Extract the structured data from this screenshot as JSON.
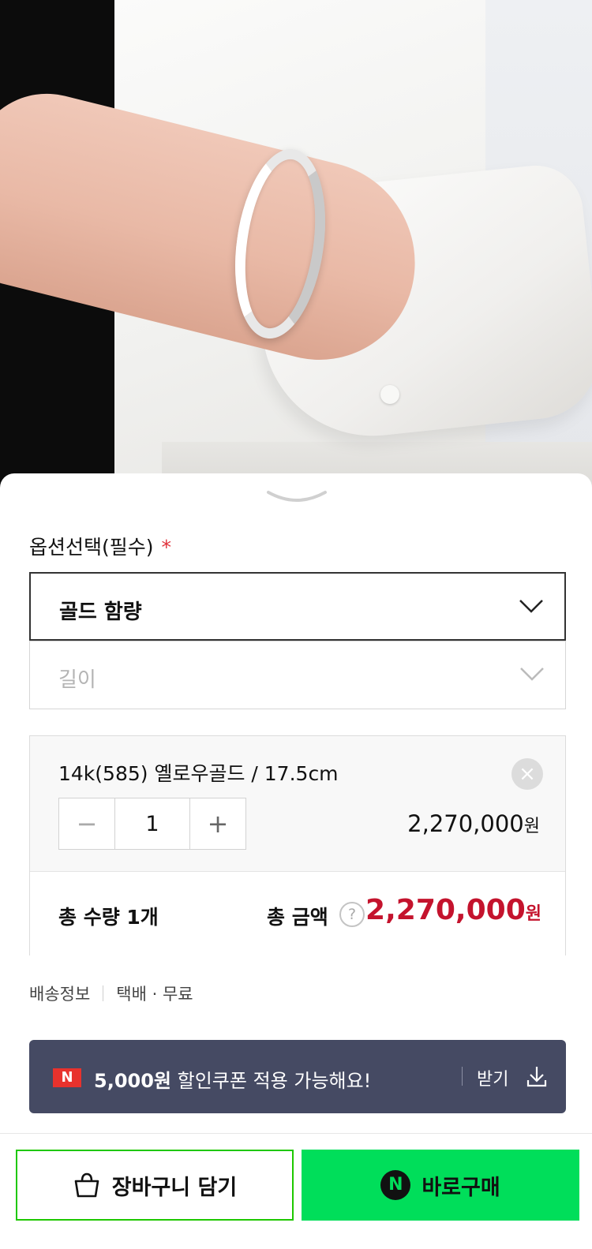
{
  "options": {
    "title": "옵션선택(필수)",
    "required_mark": "*",
    "gold_select_label": "골드 함량",
    "length_select_label": "길이"
  },
  "selected_item": {
    "name": "14k(585) 옐로우골드 / 17.5cm",
    "quantity": "1",
    "minus": "−",
    "plus": "+",
    "remove": "×",
    "price": "2,270,000",
    "price_unit": "원"
  },
  "total": {
    "quantity_label": "총 수량 1개",
    "amount_label": "총 금액",
    "help": "?",
    "amount": "2,270,000",
    "amount_unit": "원"
  },
  "shipping": {
    "label": "배송정보",
    "value": "택배 · 무료"
  },
  "coupon": {
    "logo": "N",
    "amount": "5,000원",
    "message": " 할인쿠폰 적용 가능해요!",
    "action": "받기"
  },
  "actions": {
    "cart_label": "장바구니 담기",
    "buy_logo": "N",
    "buy_label": "바로구매"
  },
  "colors": {
    "price_red": "#c4132d",
    "coupon_bg": "#454a63",
    "buy_green": "#00de5a",
    "required_red": "#e0323b"
  }
}
